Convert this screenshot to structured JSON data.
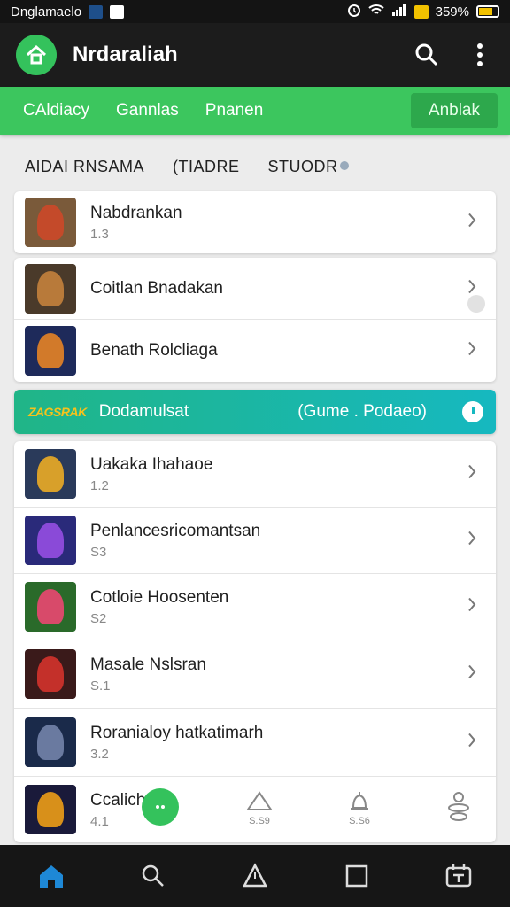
{
  "status_bar": {
    "left_text": "Dnglamaelo",
    "battery_text": "359%"
  },
  "app_bar": {
    "title": "Nrdaraliah",
    "icons": [
      "home-icon",
      "search-icon",
      "more-vertical-icon"
    ]
  },
  "tabs": [
    {
      "label": "CAldiacy"
    },
    {
      "label": "Gannlas"
    },
    {
      "label": "Pnanen"
    }
  ],
  "tab_cta": "Anblak",
  "section_headers": [
    "AIDAI RNSAMA",
    "(TIADRE",
    "STUODR"
  ],
  "card_one": [
    {
      "title": "Nabdrankan",
      "sub": "1.3",
      "thumb_bg": "#7a5a3a",
      "fig": "#c44a2a"
    }
  ],
  "card_two": [
    {
      "title": "Coitlan Bnadakan",
      "sub": "",
      "thumb_bg": "#4a3a2a",
      "fig": "#b87a3a"
    },
    {
      "title": "Benath Rolcliaga",
      "sub": "",
      "thumb_bg": "#1e2a5a",
      "fig": "#d27a2a"
    }
  ],
  "banner": {
    "badge": "ZAGSRAK",
    "title": "Dodamulsat",
    "subtitle": "(Gume . Podaeo)"
  },
  "card_three": [
    {
      "title": "Uakaka Ihahaoe",
      "sub": "1.2",
      "thumb_bg": "#2a3a5a",
      "fig": "#d8a02a"
    },
    {
      "title": "Penlancesricomantsan",
      "sub": "S3",
      "thumb_bg": "#2a2a7a",
      "fig": "#8a4ad8"
    },
    {
      "title": "Cotloie Hoosenten",
      "sub": "S2",
      "thumb_bg": "#2a6a2a",
      "fig": "#d84a6a"
    },
    {
      "title": "Masale Nslsran",
      "sub": "S.1",
      "thumb_bg": "#3a1a1a",
      "fig": "#c4302a"
    },
    {
      "title": "Roranialoy hatkatimarh",
      "sub": "3.2",
      "thumb_bg": "#1a2a4a",
      "fig": "#6a7aa0"
    },
    {
      "title": "Ccalich",
      "sub": "4.1",
      "thumb_bg": "#1a1a3a",
      "fig": "#d8901a"
    }
  ],
  "overlay_labels": [
    "S.S9",
    "S.S6"
  ],
  "bottom_nav": [
    "home-icon",
    "search-icon",
    "explore-icon",
    "square-icon",
    "library-icon"
  ],
  "colors": {
    "brand_green": "#3cc65e",
    "banner_teal": "#16b8c0",
    "active_nav": "#1e88d6"
  }
}
